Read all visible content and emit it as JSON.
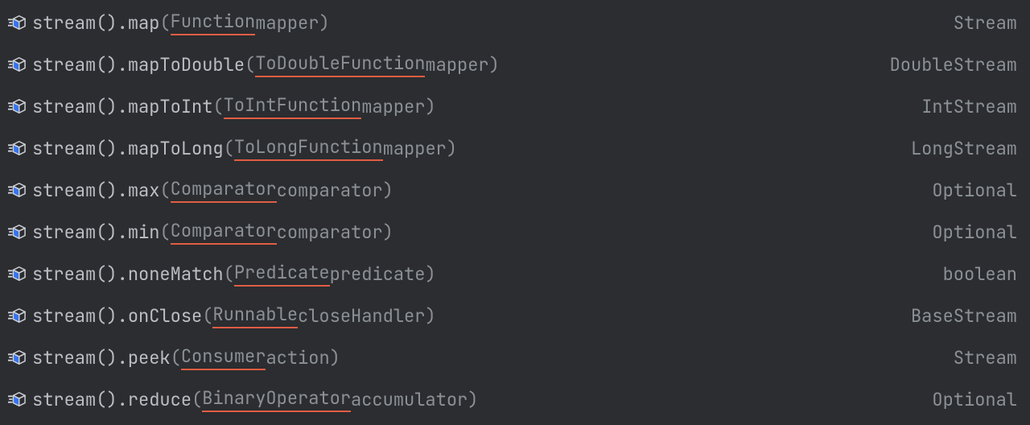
{
  "colors": {
    "bg": "#2b2d30",
    "text": "#bcbec4",
    "muted": "#8c9196",
    "underline": "#e25d43",
    "iconStroke": "#ced0d6",
    "iconFill": "#3574f0"
  },
  "completion": {
    "prefix": "stream()",
    "items": [
      {
        "name": "map",
        "paramType": "Function",
        "paramName": "mapper",
        "returnType": "Stream"
      },
      {
        "name": "mapToDouble",
        "paramType": "ToDoubleFunction",
        "paramName": "mapper",
        "returnType": "DoubleStream"
      },
      {
        "name": "mapToInt",
        "paramType": "ToIntFunction",
        "paramName": "mapper",
        "returnType": "IntStream"
      },
      {
        "name": "mapToLong",
        "paramType": "ToLongFunction",
        "paramName": "mapper",
        "returnType": "LongStream"
      },
      {
        "name": "max",
        "paramType": "Comparator",
        "paramName": "comparator",
        "returnType": "Optional"
      },
      {
        "name": "min",
        "paramType": "Comparator",
        "paramName": "comparator",
        "returnType": "Optional"
      },
      {
        "name": "noneMatch",
        "paramType": "Predicate",
        "paramName": "predicate",
        "returnType": "boolean"
      },
      {
        "name": "onClose",
        "paramType": "Runnable",
        "paramName": "closeHandler",
        "returnType": "BaseStream"
      },
      {
        "name": "peek",
        "paramType": "Consumer",
        "paramName": "action",
        "returnType": "Stream"
      },
      {
        "name": "reduce",
        "paramType": "BinaryOperator",
        "paramName": "accumulator",
        "returnType": "Optional"
      }
    ]
  }
}
